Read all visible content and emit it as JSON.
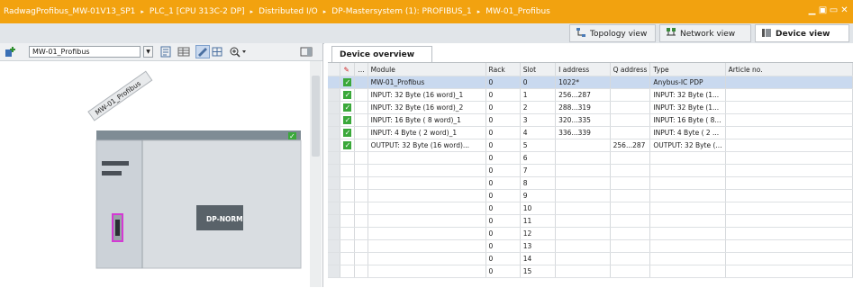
{
  "title_bar": {
    "crumbs": [
      "RadwagProfibus_MW-01V13_SP1",
      "PLC_1 [CPU 313C-2 DP]",
      "Distributed I/O",
      "DP-Mastersystem (1): PROFIBUS_1",
      "MW-01_Profibus"
    ],
    "separator": "▸",
    "controls": [
      "▁",
      "▣",
      "▭",
      "✕"
    ]
  },
  "views": {
    "topology": "Topology view",
    "network": "Network view",
    "device": "Device view"
  },
  "left_toolbar": {
    "device_select": "MW-01_Profibus",
    "zoom_icon": "zoom-icon"
  },
  "canvas": {
    "rotated_label": "MW-01_Profibus",
    "module_label": "DP-NORM",
    "status_check": "✓"
  },
  "overview": {
    "tab_label": "Device overview",
    "columns": {
      "icon": "",
      "dots": "...",
      "module": "Module",
      "rack": "Rack",
      "slot": "Slot",
      "iaddr": "I address",
      "qaddr": "Q address",
      "type": "Type",
      "article": "Article no."
    },
    "rows": [
      {
        "check": "✓",
        "module": "MW-01_Profibus",
        "rack": "0",
        "slot": "0",
        "iaddr": "1022*",
        "qaddr": "",
        "type": "Anybus-IC PDP",
        "article": ""
      },
      {
        "check": "✓",
        "module": "INPUT:  32 Byte (16 word)_1",
        "rack": "0",
        "slot": "1",
        "iaddr": "256...287",
        "qaddr": "",
        "type": "INPUT:  32 Byte (1...",
        "article": ""
      },
      {
        "check": "✓",
        "module": "INPUT:  32 Byte (16 word)_2",
        "rack": "0",
        "slot": "2",
        "iaddr": "288...319",
        "qaddr": "",
        "type": "INPUT:  32 Byte (1...",
        "article": ""
      },
      {
        "check": "✓",
        "module": "INPUT:  16 Byte ( 8 word)_1",
        "rack": "0",
        "slot": "3",
        "iaddr": "320...335",
        "qaddr": "",
        "type": "INPUT:  16 Byte ( 8...",
        "article": ""
      },
      {
        "check": "✓",
        "module": "INPUT:   4 Byte ( 2 word)_1",
        "rack": "0",
        "slot": "4",
        "iaddr": "336...339",
        "qaddr": "",
        "type": "INPUT:   4 Byte ( 2 ...",
        "article": ""
      },
      {
        "check": "✓",
        "module": "OUTPUT: 32 Byte (16 word)...",
        "rack": "0",
        "slot": "5",
        "iaddr": "",
        "qaddr": "256...287",
        "type": "OUTPUT: 32 Byte (...",
        "article": ""
      },
      {
        "check": "",
        "module": "",
        "rack": "0",
        "slot": "6",
        "iaddr": "",
        "qaddr": "",
        "type": "",
        "article": ""
      },
      {
        "check": "",
        "module": "",
        "rack": "0",
        "slot": "7",
        "iaddr": "",
        "qaddr": "",
        "type": "",
        "article": ""
      },
      {
        "check": "",
        "module": "",
        "rack": "0",
        "slot": "8",
        "iaddr": "",
        "qaddr": "",
        "type": "",
        "article": ""
      },
      {
        "check": "",
        "module": "",
        "rack": "0",
        "slot": "9",
        "iaddr": "",
        "qaddr": "",
        "type": "",
        "article": ""
      },
      {
        "check": "",
        "module": "",
        "rack": "0",
        "slot": "10",
        "iaddr": "",
        "qaddr": "",
        "type": "",
        "article": ""
      },
      {
        "check": "",
        "module": "",
        "rack": "0",
        "slot": "11",
        "iaddr": "",
        "qaddr": "",
        "type": "",
        "article": ""
      },
      {
        "check": "",
        "module": "",
        "rack": "0",
        "slot": "12",
        "iaddr": "",
        "qaddr": "",
        "type": "",
        "article": ""
      },
      {
        "check": "",
        "module": "",
        "rack": "0",
        "slot": "13",
        "iaddr": "",
        "qaddr": "",
        "type": "",
        "article": ""
      },
      {
        "check": "",
        "module": "",
        "rack": "0",
        "slot": "14",
        "iaddr": "",
        "qaddr": "",
        "type": "",
        "article": ""
      },
      {
        "check": "",
        "module": "",
        "rack": "0",
        "slot": "15",
        "iaddr": "",
        "qaddr": "",
        "type": "",
        "article": ""
      }
    ]
  },
  "colors": {
    "title_bar": "#f2a20f",
    "selected_row": "#c9d9ef",
    "check_green": "#3aa83a",
    "module_highlight": "#d43ad4",
    "rack_header": "#7f8c95"
  }
}
